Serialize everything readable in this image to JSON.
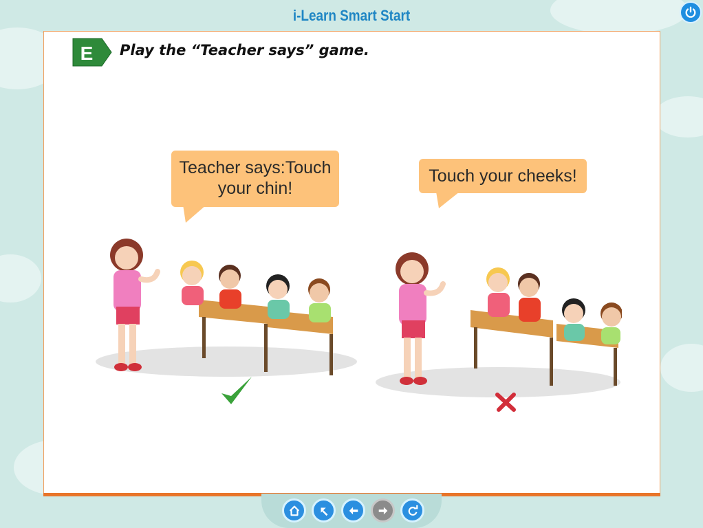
{
  "header": {
    "title": "i-Learn Smart Start"
  },
  "exercise": {
    "badge_letter": "E",
    "instruction": "Play the “Teacher says” game."
  },
  "scenes": [
    {
      "bubble_line1": "Teacher says:Touch",
      "bubble_line2": "your chin!",
      "result": "check-icon"
    },
    {
      "bubble_text": "Touch your cheeks!",
      "result": "cross-icon"
    }
  ],
  "nav": [
    {
      "name": "home-button",
      "icon": "home-icon"
    },
    {
      "name": "up-button",
      "icon": "arrow-up-left-icon"
    },
    {
      "name": "back-button",
      "icon": "arrow-left-icon"
    },
    {
      "name": "forward-button",
      "icon": "arrow-right-icon",
      "disabled": true
    },
    {
      "name": "refresh-button",
      "icon": "refresh-icon"
    }
  ],
  "colors": {
    "accent": "#1f86c4",
    "badge": "#2e8a3a",
    "bubble": "#fdc27a",
    "frame": "#e8752a"
  }
}
